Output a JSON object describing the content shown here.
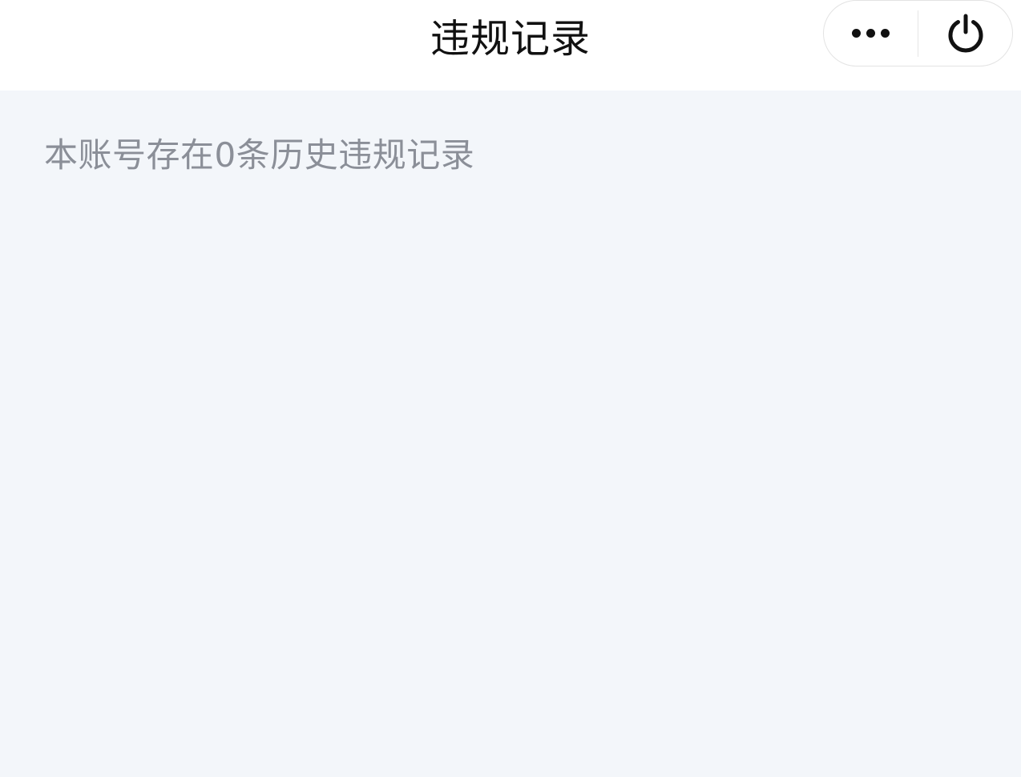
{
  "navbar": {
    "title": "违规记录",
    "more_icon": "more-dots-icon",
    "close_icon": "power-icon"
  },
  "content": {
    "summary_text": "本账号存在0条历史违规记录"
  },
  "colors": {
    "page_background": "#f3f6fa",
    "navbar_background": "#ffffff",
    "title_color": "#111111",
    "secondary_text": "#8b8f98"
  }
}
